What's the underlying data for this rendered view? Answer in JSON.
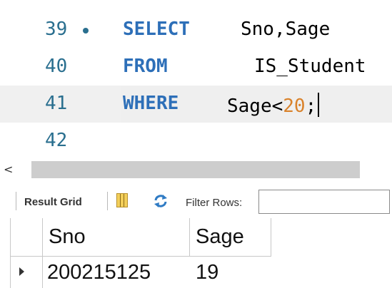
{
  "editor": {
    "lines": [
      {
        "number": "39",
        "keyword": "SELECT",
        "text": "Sno,Sage"
      },
      {
        "number": "40",
        "keyword": "FROM",
        "text": "IS_Student"
      },
      {
        "number": "41",
        "keyword": "WHERE",
        "text_before": "Sage",
        "op": "<",
        "num": "20",
        "semi": ";"
      },
      {
        "number": "42"
      }
    ]
  },
  "scrollbar": {
    "left_arrow": "<"
  },
  "toolbar": {
    "result_grid_label": "Result Grid",
    "filter_label": "Filter Rows:",
    "filter_value": ""
  },
  "grid": {
    "columns": [
      "Sno",
      "Sage"
    ],
    "rows": [
      [
        "200215125",
        "19"
      ]
    ]
  },
  "colors": {
    "keyword": "#2d6fb8",
    "line_number": "#2a6f8f",
    "number_literal": "#d9822b"
  }
}
